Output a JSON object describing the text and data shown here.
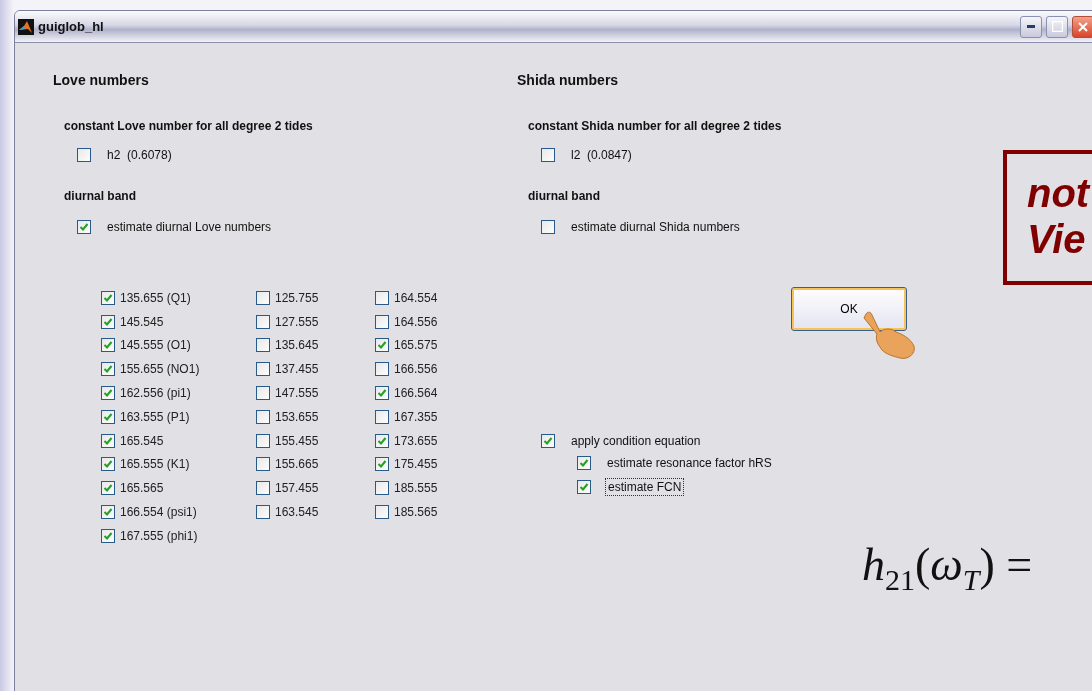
{
  "window": {
    "title": "guiglob_hl"
  },
  "love": {
    "heading": "Love numbers",
    "constant_heading": "constant Love number for all degree 2 tides",
    "constant": {
      "label": "h2  (0.6078)",
      "checked": false
    },
    "diurnal_heading": "diurnal band",
    "diurnal": {
      "label": "estimate diurnal Love numbers",
      "checked": true
    },
    "columns": [
      {
        "items": [
          {
            "label": "135.655 (Q1)",
            "checked": true
          },
          {
            "label": "145.545",
            "checked": true
          },
          {
            "label": "145.555 (O1)",
            "checked": true
          },
          {
            "label": "155.655 (NO1)",
            "checked": true
          },
          {
            "label": "162.556 (pi1)",
            "checked": true
          },
          {
            "label": "163.555 (P1)",
            "checked": true
          },
          {
            "label": "165.545",
            "checked": true
          },
          {
            "label": "165.555 (K1)",
            "checked": true
          },
          {
            "label": "165.565",
            "checked": true
          },
          {
            "label": "166.554 (psi1)",
            "checked": true
          },
          {
            "label": "167.555 (phi1)",
            "checked": true
          }
        ]
      },
      {
        "items": [
          {
            "label": "125.755",
            "checked": false
          },
          {
            "label": "127.555",
            "checked": false
          },
          {
            "label": "135.645",
            "checked": false
          },
          {
            "label": "137.455",
            "checked": false
          },
          {
            "label": "147.555",
            "checked": false
          },
          {
            "label": "153.655",
            "checked": false
          },
          {
            "label": "155.455",
            "checked": false
          },
          {
            "label": "155.665",
            "checked": false
          },
          {
            "label": "157.455",
            "checked": false
          },
          {
            "label": "163.545",
            "checked": false
          }
        ]
      },
      {
        "items": [
          {
            "label": "164.554",
            "checked": false
          },
          {
            "label": "164.556",
            "checked": false
          },
          {
            "label": "165.575",
            "checked": true
          },
          {
            "label": "166.556",
            "checked": false
          },
          {
            "label": "166.564",
            "checked": true
          },
          {
            "label": "167.355",
            "checked": false
          },
          {
            "label": "173.655",
            "checked": true
          },
          {
            "label": "175.455",
            "checked": true
          },
          {
            "label": "185.555",
            "checked": false
          },
          {
            "label": "185.565",
            "checked": false
          }
        ]
      }
    ]
  },
  "shida": {
    "heading": "Shida numbers",
    "constant_heading": "constant Shida number for all degree 2 tides",
    "constant": {
      "label": "l2  (0.0847)",
      "checked": false
    },
    "diurnal_heading": "diurnal band",
    "diurnal": {
      "label": "estimate diurnal Shida numbers",
      "checked": false
    },
    "ok_button": "OK",
    "condition": {
      "label": "apply condition equation",
      "checked": true
    },
    "condition_options": [
      {
        "label": "estimate resonance factor hRS",
        "checked": true,
        "focused": false
      },
      {
        "label": "estimate FCN",
        "checked": true,
        "focused": true
      }
    ]
  },
  "callout": {
    "lines": [
      "not",
      "Vie"
    ]
  },
  "formula": "*h*$_{21}$(*ω*$_{T}$) ="
}
